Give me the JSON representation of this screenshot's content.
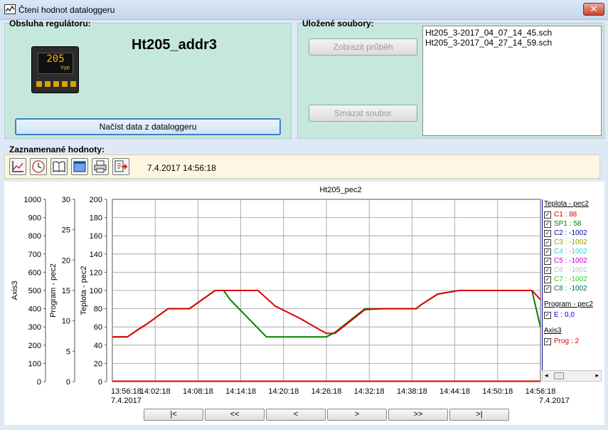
{
  "window": {
    "title": "Čtení hodnot dataloggeru",
    "close_label": "✕"
  },
  "regulator": {
    "panel_label": "Obsluha regulátoru:",
    "device_name": "Ht205_addr3",
    "device_display": "205",
    "device_display_sub": "Vyp",
    "read_button": "Načíst data z dataloggeru"
  },
  "files": {
    "panel_label": "Uložené soubory:",
    "show_button": "Zobrazit průběh",
    "delete_button": "Smazat soubor",
    "items": [
      "Ht205_3-2017_04_07_14_45.sch",
      "Ht205_3-2017_04_27_14_59.sch"
    ]
  },
  "recorded": {
    "panel_label": "Zaznamenané hodnoty:",
    "timestamp": "7.4.2017 14:56:18",
    "toolbar_icons": [
      "chart-icon",
      "clock-icon",
      "book-icon",
      "window-icon",
      "print-icon",
      "export-icon"
    ]
  },
  "chart_data": {
    "type": "line",
    "title": "Ht205_pec2",
    "axes": [
      {
        "label": "Axis3",
        "ticks": [
          "1000",
          "900",
          "800",
          "700",
          "600",
          "500",
          "400",
          "300",
          "200",
          "100",
          "0"
        ],
        "range": [
          0,
          1000
        ]
      },
      {
        "label": "Program - pec2",
        "ticks": [
          "30",
          "25",
          "20",
          "15",
          "10",
          "5",
          "0"
        ],
        "range": [
          0,
          30
        ]
      },
      {
        "label": "Teplota - pec2",
        "ticks": [
          "200",
          "180",
          "160",
          "140",
          "120",
          "100",
          "80",
          "60",
          "40",
          "20",
          "0"
        ],
        "range": [
          0,
          200
        ]
      }
    ],
    "x_ticks": [
      "13:56:18",
      "14:02:18",
      "14:08:18",
      "14:14:18",
      "14:20:18",
      "14:26:18",
      "14:32:18",
      "14:38:18",
      "14:44:18",
      "14:50:18",
      "14:56:18"
    ],
    "x_start_date": "7.4.2017",
    "x_end_date": "7.4.2017",
    "grid": true,
    "series": [
      {
        "name": "SP1",
        "color": "#008000",
        "x": [
          0,
          3.5,
          6.0,
          8.0,
          13.0,
          18.0,
          24.0,
          26.0,
          27.5,
          36.0,
          40.0,
          46.0,
          50.0,
          52.0,
          59.0,
          63.0,
          65.5,
          71.0,
          72.0,
          76.0,
          81.0,
          87.0,
          89.5,
          98.0,
          100.5
        ],
        "y": [
          49,
          49,
          57,
          63,
          80,
          80,
          100,
          100,
          90,
          49,
          49,
          49,
          49,
          54,
          80,
          80,
          80,
          80,
          84,
          96,
          100,
          100,
          100,
          100,
          60
        ]
      },
      {
        "name": "C1",
        "color": "#dd0000",
        "x": [
          0,
          3.5,
          6.0,
          8.0,
          13.0,
          18.0,
          24.0,
          28.0,
          31.0,
          34.0,
          38.0,
          44.0,
          48.0,
          50.0,
          52.0,
          59.0,
          63.0,
          65.5,
          71.0,
          72.0,
          76.0,
          81.0,
          87.0,
          89.5,
          98.0,
          100.5
        ],
        "y": [
          49,
          49,
          57,
          63,
          80,
          80,
          100,
          100,
          100,
          100,
          83,
          69,
          58,
          53,
          53,
          79,
          80,
          80,
          80,
          84,
          96,
          100,
          100,
          100,
          100,
          90
        ]
      },
      {
        "name": "Prog",
        "color": "#dd0000",
        "x": [
          0,
          100.5
        ],
        "y": [
          2,
          2
        ]
      }
    ]
  },
  "legend": {
    "groups": [
      {
        "title": "Teplota - pec2",
        "rows": [
          {
            "text": "C1 : 88",
            "color": "#dd0000"
          },
          {
            "text": "SP1 : 58",
            "color": "#008000"
          },
          {
            "text": "C2 : -1002",
            "color": "#000099"
          },
          {
            "text": "C3 : -1002",
            "color": "#999900"
          },
          {
            "text": "C4 : -1002",
            "color": "#33cccc"
          },
          {
            "text": "C5 : -1002",
            "color": "#cc00cc"
          },
          {
            "text": "C6 : -1002",
            "color": "#c0c0c0"
          },
          {
            "text": "C7 : -1002",
            "color": "#33cc33"
          },
          {
            "text": "C8 : -1002",
            "color": "#006666"
          }
        ]
      },
      {
        "title": "Program - pec2",
        "rows": [
          {
            "text": "E : 0,0",
            "color": "#0000cc"
          }
        ]
      },
      {
        "title": "Axis3",
        "rows": [
          {
            "text": "Prog : 2",
            "color": "#dd0000"
          }
        ]
      }
    ]
  },
  "navigation": [
    "|<",
    "<<",
    "<",
    ">",
    ">>",
    ">|"
  ]
}
